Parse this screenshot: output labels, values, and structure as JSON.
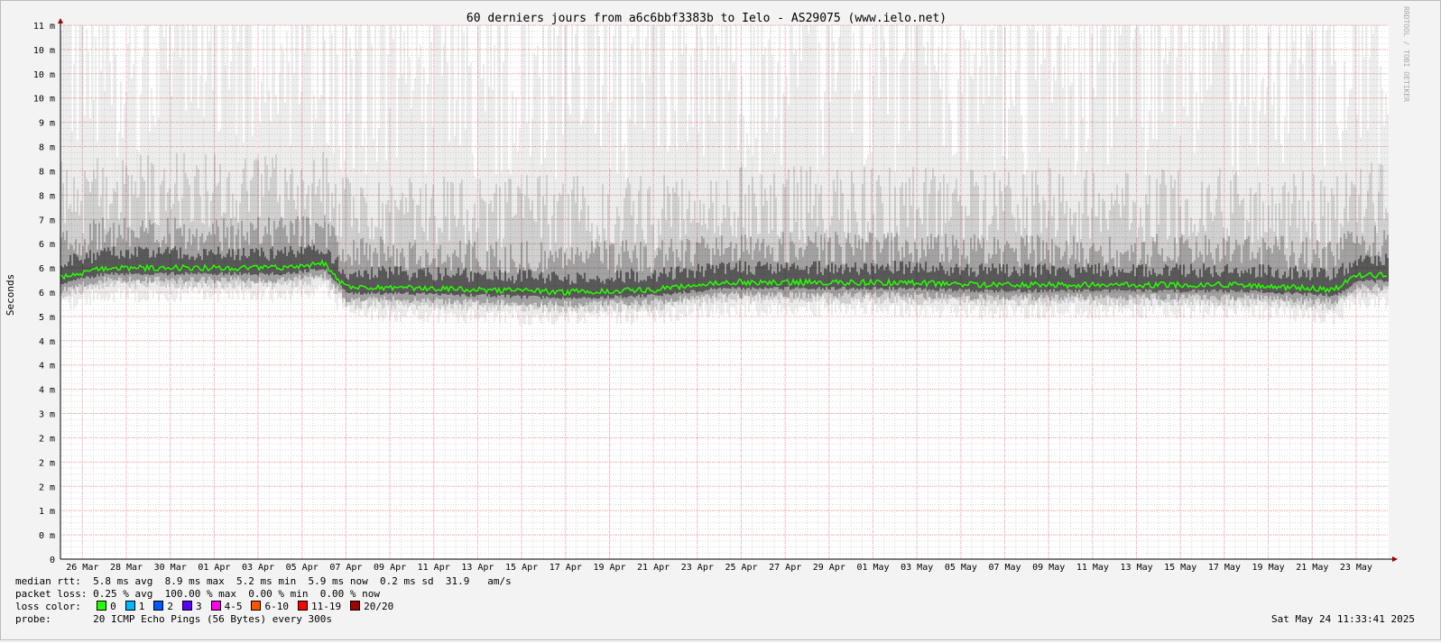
{
  "chart_data": {
    "type": "area",
    "title": "60 derniers jours from a6c6bbf3383b to Ielo - AS29075 (www.ielo.net)",
    "ylabel": "Seconds",
    "xlabel": "",
    "y_tick_labels": [
      "0",
      "0 m",
      "1 m",
      "2 m",
      "2 m",
      "2 m",
      "3 m",
      "4 m",
      "4 m",
      "4 m",
      "5 m",
      "6 m",
      "6 m",
      "6 m",
      "7 m",
      "8 m",
      "8 m",
      "8 m",
      "9 m",
      "10 m",
      "10 m",
      "10 m",
      "11 m"
    ],
    "ylim_ms": [
      0,
      11
    ],
    "x_tick_labels": [
      "26 Mar",
      "28 Mar",
      "30 Mar",
      "01 Apr",
      "03 Apr",
      "05 Apr",
      "07 Apr",
      "09 Apr",
      "11 Apr",
      "13 Apr",
      "15 Apr",
      "17 Apr",
      "19 Apr",
      "21 Apr",
      "23 Apr",
      "25 Apr",
      "27 Apr",
      "29 Apr",
      "01 May",
      "03 May",
      "05 May",
      "07 May",
      "09 May",
      "11 May",
      "13 May",
      "15 May",
      "17 May",
      "19 May",
      "21 May",
      "23 May"
    ],
    "grid": true,
    "series": [
      {
        "name": "median rtt",
        "median_ms": [
          [
            "2025-03-25",
            5.8
          ],
          [
            "2025-03-27",
            6.0
          ],
          [
            "2025-03-29",
            6.0
          ],
          [
            "2025-03-31",
            6.0
          ],
          [
            "2025-04-02",
            6.0
          ],
          [
            "2025-04-04",
            6.0
          ],
          [
            "2025-04-06",
            6.1
          ],
          [
            "2025-04-07",
            5.6
          ],
          [
            "2025-04-09",
            5.6
          ],
          [
            "2025-04-13",
            5.55
          ],
          [
            "2025-04-17",
            5.5
          ],
          [
            "2025-04-21",
            5.55
          ],
          [
            "2025-04-24",
            5.7
          ],
          [
            "2025-04-28",
            5.7
          ],
          [
            "2025-05-02",
            5.7
          ],
          [
            "2025-05-06",
            5.65
          ],
          [
            "2025-05-10",
            5.65
          ],
          [
            "2025-05-14",
            5.65
          ],
          [
            "2025-05-18",
            5.65
          ],
          [
            "2025-05-22",
            5.55
          ],
          [
            "2025-05-23",
            5.85
          ],
          [
            "2025-05-24",
            5.85
          ]
        ]
      }
    ]
  },
  "legend": {
    "median_rtt_label": "median rtt:",
    "median_rtt_values": "5.8 ms avg  8.9 ms max  5.2 ms min  5.9 ms now  0.2 ms sd  31.9   am/s",
    "packet_loss_label": "packet loss:",
    "packet_loss_values": "0.25 % avg  100.00 % max  0.00 % min  0.00 % now",
    "loss_color_label": "loss color:",
    "loss_colors": [
      {
        "label": "0",
        "color": "#26ff00"
      },
      {
        "label": "1",
        "color": "#00b8ff"
      },
      {
        "label": "2",
        "color": "#0059ff"
      },
      {
        "label": "3",
        "color": "#5e00ff"
      },
      {
        "label": "4-5",
        "color": "#ff00e8"
      },
      {
        "label": "6-10",
        "color": "#ff5500"
      },
      {
        "label": "11-19",
        "color": "#ff0000"
      },
      {
        "label": "20/20",
        "color": "#a10000"
      }
    ],
    "probe_label": "probe:",
    "probe_value": "20 ICMP Echo Pings (56 Bytes) every 300s",
    "timestamp": "Sat May 24 11:33:41 2025"
  },
  "watermark": "RRDTOOL / TOBI OETIKER",
  "colors": {
    "background": "#f3f3f3",
    "plot_background": "#ffffff",
    "major_grid": "#f2a8a8",
    "minor_grid": "#d8d8d8",
    "median_line": "#26ff00",
    "smoke": "#000000"
  }
}
